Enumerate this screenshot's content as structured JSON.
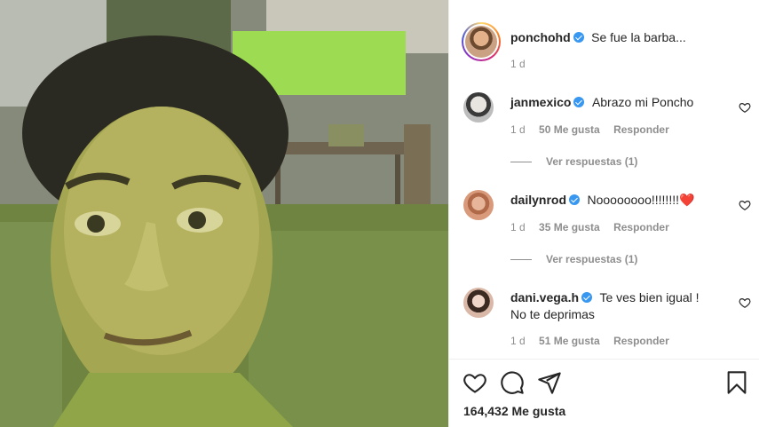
{
  "post": {
    "author": "ponchohd",
    "caption": "Se fue la barba...",
    "age": "1 d"
  },
  "comments": [
    {
      "user": "janmexico",
      "text": "Abrazo mi Poncho",
      "age": "1 d",
      "likes": "50 Me gusta",
      "reply": "Responder",
      "view_replies": "Ver respuestas (1)"
    },
    {
      "user": "dailynrod",
      "text": "Noooooooo!!!!!!!!",
      "emoji": "❤️",
      "age": "1 d",
      "likes": "35 Me gusta",
      "reply": "Responder",
      "view_replies": "Ver respuestas (1)"
    },
    {
      "user": "dani.vega.h",
      "text_line1": "Te ves bien igual !",
      "text_line2": "No te deprimas",
      "age": "1 d",
      "likes": "51 Me gusta",
      "reply": "Responder"
    }
  ],
  "footer": {
    "likes": "164,432 Me gusta"
  },
  "icons": {
    "like": "heart-icon",
    "comment": "comment-bubble-icon",
    "share": "paper-plane-icon",
    "save": "bookmark-icon",
    "verified": "verified-badge-icon"
  },
  "colors": {
    "verified": "#3897f0",
    "heart_emoji": "#e0245e",
    "muted_text": "#8e8e8e"
  }
}
